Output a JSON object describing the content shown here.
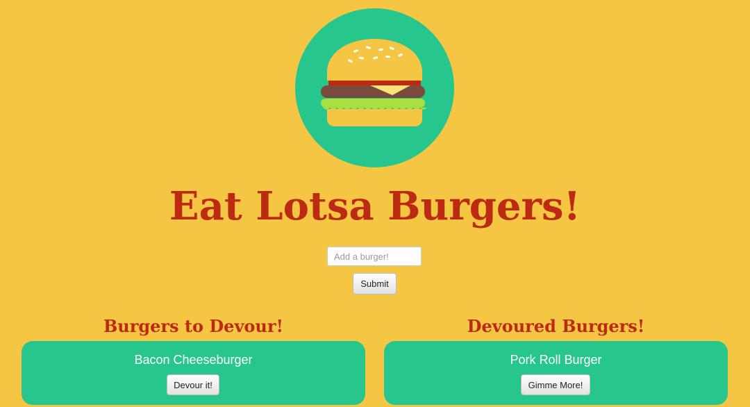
{
  "header": {
    "logo_icon": "burger-icon",
    "title": "Eat Lotsa Burgers!"
  },
  "form": {
    "input_placeholder": "Add a burger!",
    "input_value": "",
    "submit_label": "Submit"
  },
  "columns": {
    "to_devour": {
      "heading": "Burgers to Devour!",
      "items": [
        {
          "name": "Bacon Cheeseburger",
          "button_label": "Devour it!"
        }
      ]
    },
    "devoured": {
      "heading": "Devoured Burgers!",
      "items": [
        {
          "name": "Pork Roll Burger",
          "button_label": "Gimme More!"
        }
      ]
    }
  },
  "colors": {
    "background": "#f5c644",
    "accent_green": "#26c68c",
    "title_red": "#bd2a12",
    "card_text": "#ffffff"
  }
}
